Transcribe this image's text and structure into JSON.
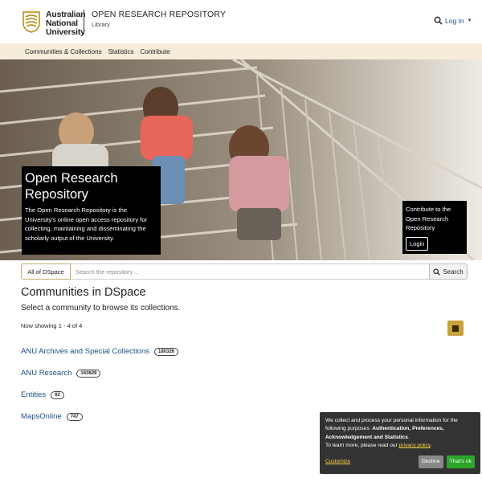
{
  "header": {
    "logo_lines": [
      "Australian",
      "National",
      "University"
    ],
    "site_title": "OPEN RESEARCH REPOSITORY",
    "site_subtitle": "Library",
    "login_label": "Log In",
    "search_icon": "search-icon",
    "caret_icon": "caret-down-icon"
  },
  "nav": {
    "items": [
      {
        "label": "Communities & Collections"
      },
      {
        "label": "Statistics"
      },
      {
        "label": "Contribute"
      }
    ]
  },
  "hero": {
    "title": "Open Research Repository",
    "description": "The Open Research Repository is the University's online open access repository for collecting, maintaining and disseminating the scholarly output of the University.",
    "contribute_text": "Contribute to the Open Research Repository",
    "login_button": "Login"
  },
  "search": {
    "scope_label": "All of DSpace",
    "placeholder": "Search the repository ...",
    "button_label": "Search"
  },
  "main": {
    "title": "Communities in DSpace",
    "subtitle": "Select a community to browse its collections.",
    "showing": "Now showing 1 - 4 of 4",
    "rss_icon": "rss-icon",
    "communities": [
      {
        "name": "ANU Archives and Special Collections",
        "count": "180326"
      },
      {
        "name": "ANU Research",
        "count": "163629"
      },
      {
        "name": "Entities",
        "count": "62"
      },
      {
        "name": "MapsOnline",
        "count": "747"
      }
    ]
  },
  "cookie": {
    "text_intro": "We collect and process your personal information for the following purposes: ",
    "purposes": "Authentication, Preferences, Acknowledgement and Statistics",
    "text_period": ".",
    "learn_more": "To learn more, please read our ",
    "policy_link": "privacy policy",
    "learn_end": ".",
    "customize": "Customize",
    "decline": "Decline",
    "accept": "That's ok"
  },
  "colors": {
    "link": "#1a4f8a",
    "nav_bg": "#f5ecd9",
    "accent_gold": "#c8a23a",
    "cookie_bg": "#333333",
    "accept_green": "#2aa52a"
  }
}
